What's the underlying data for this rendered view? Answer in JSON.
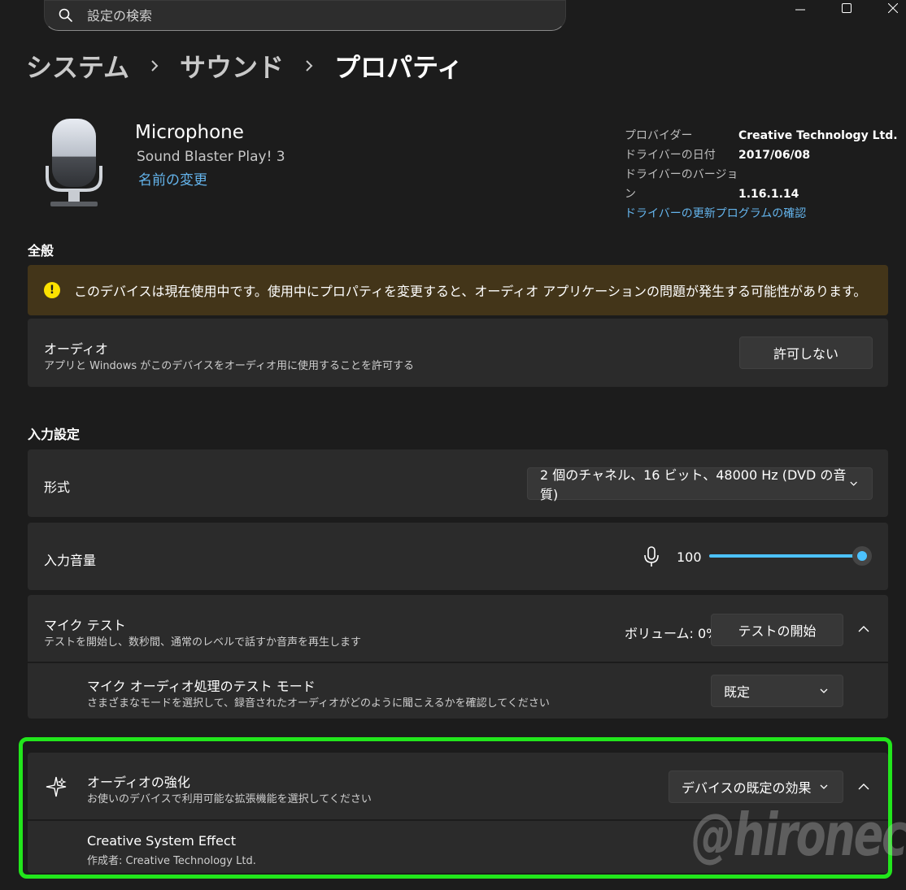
{
  "search": {
    "placeholder": "設定の検索"
  },
  "breadcrumb": {
    "items": [
      "システム",
      "サウンド",
      "プロパティ"
    ]
  },
  "device": {
    "name": "Microphone",
    "model": "Sound Blaster Play! 3",
    "rename_link": "名前の変更",
    "provider_label": "プロバイダー",
    "provider_value": "Creative Technology Ltd.",
    "date_label": "ドライバーの日付",
    "date_value": "2017/06/08",
    "version_label": "ドライバーのバージョン",
    "version_value": "1.16.1.14",
    "update_link": "ドライバーの更新プログラムの確認"
  },
  "general": {
    "heading": "全般",
    "warning": "このデバイスは現在使用中です。使用中にプロパティを変更すると、オーディオ アプリケーションの問題が発生する可能性があります。",
    "audio_title": "オーディオ",
    "audio_desc": "アプリと Windows がこのデバイスをオーディオ用に使用することを許可する",
    "audio_button": "許可しない"
  },
  "input": {
    "heading": "入力設定",
    "format_label": "形式",
    "format_value": "2 個のチャネル、16 ビット、48000 Hz (DVD の音質)",
    "volume_label": "入力音量",
    "volume_value": "100",
    "volume_fraction": 1.0,
    "mic_test_title": "マイク テスト",
    "mic_test_desc": "テストを開始し、数秒間、通常のレベルで話すか音声を再生します",
    "volume_readout": "ボリューム: 0%",
    "test_button": "テストの開始",
    "test_mode_title": "マイク オーディオ処理のテスト モード",
    "test_mode_desc": "さまざまなモードを選択して、録音されたオーディオがどのように聞こえるかを確認してください",
    "test_mode_value": "既定"
  },
  "enhance": {
    "title": "オーディオの強化",
    "desc": "お使いのデバイスで利用可能な拡張機能を選択してください",
    "value": "デバイスの既定の効果",
    "effect_title": "Creative System Effect",
    "effect_author": "作成者: Creative Technology Ltd."
  },
  "watermark": "@hironechar",
  "colors": {
    "accent": "#64b4ec",
    "slider": "#4cc2ff",
    "warning_bg": "#433519",
    "highlight": "#22e61c"
  },
  "icons": [
    "search-icon",
    "minimize-icon",
    "maximize-icon",
    "close-icon",
    "microphone-device-icon",
    "warning-icon",
    "microphone-icon",
    "chevron-up-icon",
    "chevron-down-icon",
    "sparkle-icon"
  ]
}
